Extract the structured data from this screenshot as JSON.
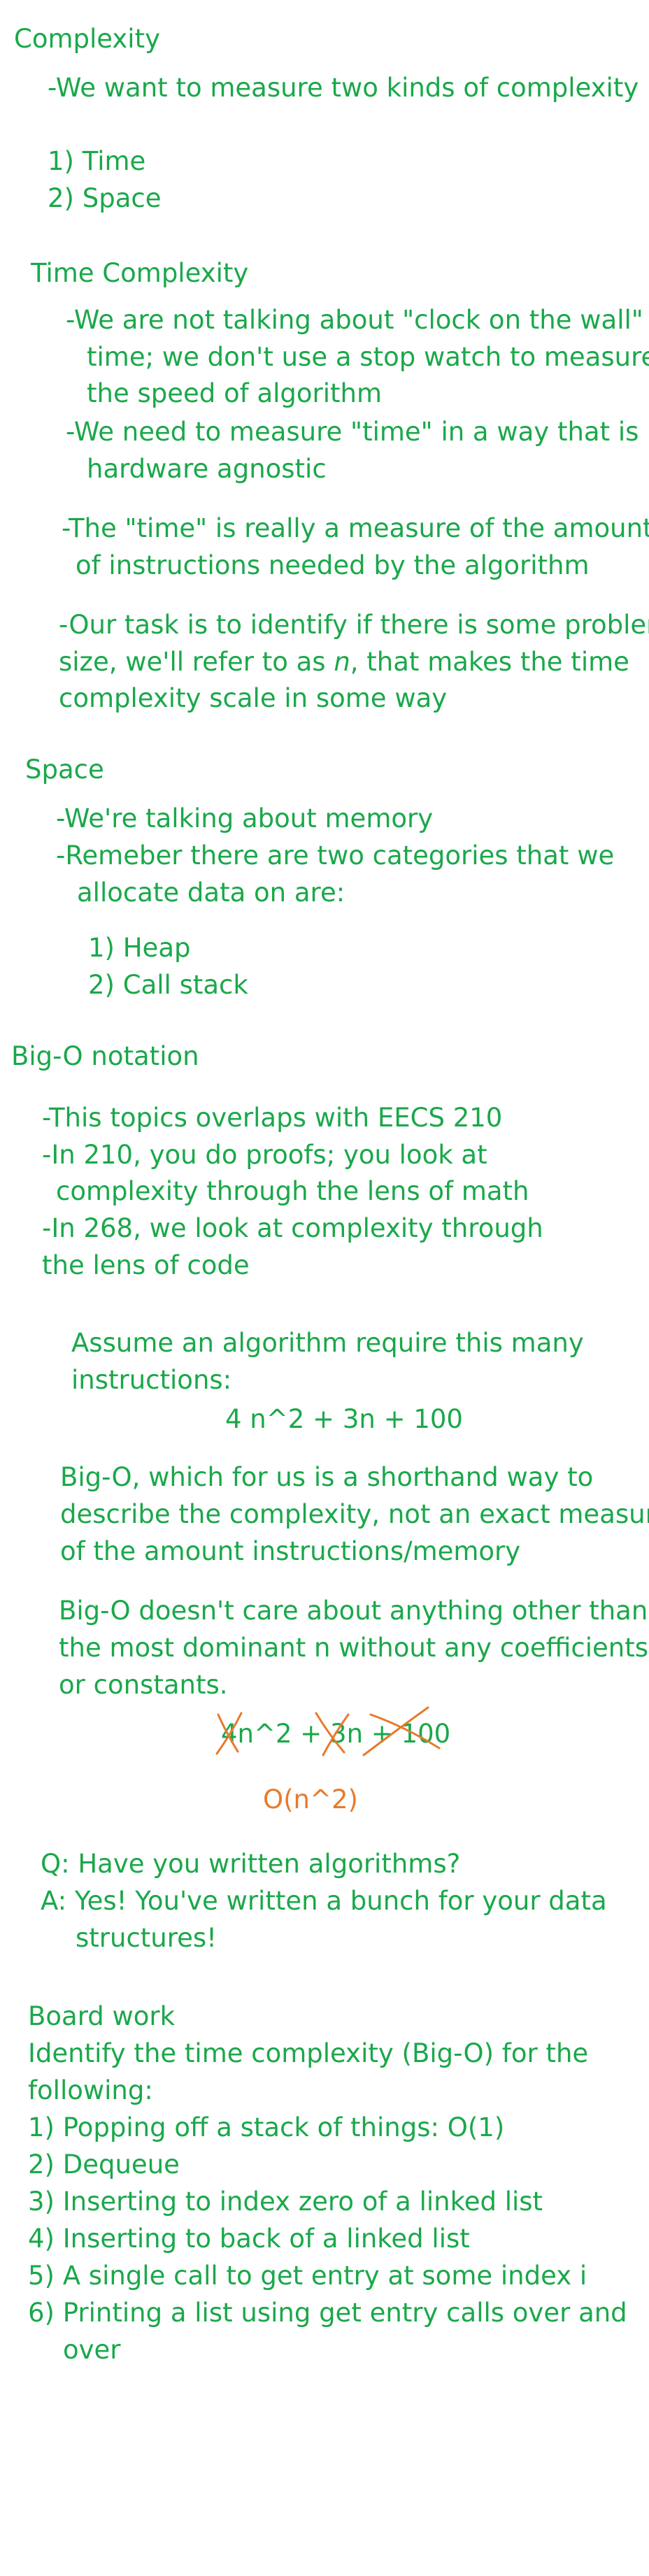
{
  "heading_complexity": "Complexity",
  "intro": "-We want to measure two kinds of complexity",
  "kinds": [
    "1) Time",
    "2) Space"
  ],
  "time_section": {
    "heading": "Time Complexity",
    "lines": [
      "-We are not talking about \"clock on the wall\"",
      "time; we don't use a stop watch to measure",
      "the speed of algorithm",
      "-We need to measure \"time\" in a way that is",
      "hardware agnostic",
      "-The \"time\" is really a measure of the amount",
      "of instructions needed by the algorithm",
      "-Our task is to identify if there is some problem",
      "complexity scale in some way"
    ],
    "size_line_pre": "size, we'll refer to as ",
    "size_line_var": "n",
    "size_line_post": ", that makes the time"
  },
  "space_section": {
    "heading": "Space",
    "lines": [
      "-We're talking about memory",
      "-Remeber there are two categories that we",
      "allocate data on are:"
    ],
    "items": [
      "1) Heap",
      "2) Call stack"
    ]
  },
  "bigo_section": {
    "heading": "Big-O notation",
    "lines": [
      "-This topics overlaps with EECS 210",
      "-In 210, you do proofs; you look at",
      "complexity through the lens of math",
      "-In 268, we look at complexity through",
      "the lens of code"
    ],
    "assume": [
      "Assume an algorithm require this many",
      "instructions:"
    ],
    "formula": "4 n^2 + 3n + 100",
    "shorthand": [
      "Big-O, which for us is a shorthand way to",
      "describe the complexity, not an exact measure",
      "of the amount instructions/memory"
    ],
    "dominant": [
      "Big-O doesn't care about anything other than",
      "the most dominant n without any coefficients",
      "or constants."
    ],
    "crossed_formula": "4n^2 + 3n + 100",
    "result": "O(n^2)",
    "qa": [
      "Q: Have you written algorithms?",
      "A: Yes! You've written a bunch for your data",
      "structures!"
    ]
  },
  "board_work": {
    "heading": "Board work",
    "prompt": [
      "Identify the time complexity (Big-O) for the",
      "following:"
    ],
    "items": [
      "1) Popping off a stack of things:   O(1)",
      "2) Dequeue",
      "3) Inserting to index zero of a linked list",
      "4) Inserting to back of a linked list",
      "5) A single call to get entry at some index i",
      "6) Printing a list using get entry calls over and",
      "over"
    ]
  },
  "colors": {
    "text": "#1aa84a",
    "annotation": "#e87a2c",
    "background": "#ffffff"
  }
}
